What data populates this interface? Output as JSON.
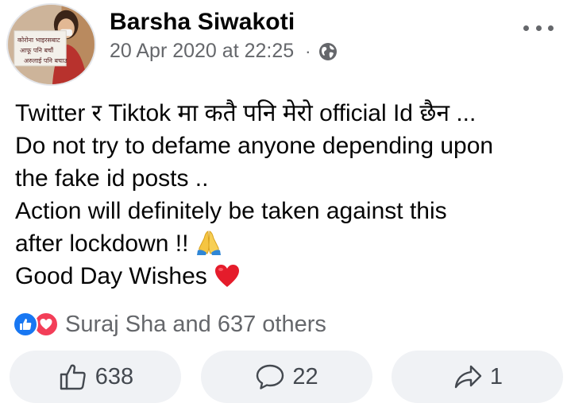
{
  "post": {
    "author": "Barsha Siwakoti",
    "timestamp": "20 Apr 2020 at 22:25",
    "separator": "·",
    "privacy_icon": "globe-icon",
    "avatar_sign": {
      "line1": "कोरोना भाइरसबाट",
      "line2": "आफू पनि बचौं",
      "line3": "अरुलाई पनि बचाउ"
    },
    "lines": [
      "Twitter र Tiktok मा कतै पनि मेरो official Id छैन ...",
      "Do not try to defame anyone depending upon",
      "the fake id posts ..",
      "Action will definitely be taken against this",
      "after lockdown !!",
      "Good Day Wishes"
    ],
    "emojis": {
      "line5": "folded-hands-emoji",
      "line6": "red-heart-emoji"
    }
  },
  "reactions": {
    "summary": "Suraj Sha and 637 others",
    "icons": [
      "like-reaction-icon",
      "love-reaction-icon"
    ]
  },
  "actions": {
    "like_count": "638",
    "comment_count": "22",
    "share_count": "1"
  },
  "colors": {
    "facebook_blue": "#1877f2",
    "love_red": "#f33e58",
    "secondary_text": "#65676b",
    "button_bg": "#f0f2f5"
  }
}
